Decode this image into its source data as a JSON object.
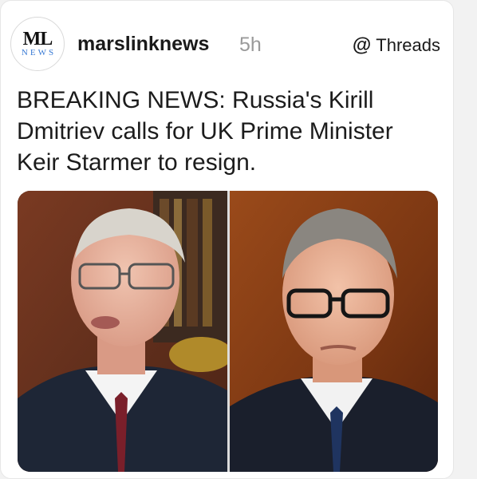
{
  "post": {
    "logo": {
      "top": "ML",
      "bottom": "NEWS"
    },
    "username": "marslinknews",
    "time": "5h",
    "platform": {
      "icon": "threads-icon",
      "label": "Threads"
    },
    "headline": "BREAKING NEWS: Russia's Kirill Dmitriev calls for UK Prime Minister Keir Starmer to resign."
  },
  "colors": {
    "logo_news": "#3a7bd5",
    "time_text": "#9a9a9a",
    "text": "#1a1a1a"
  }
}
